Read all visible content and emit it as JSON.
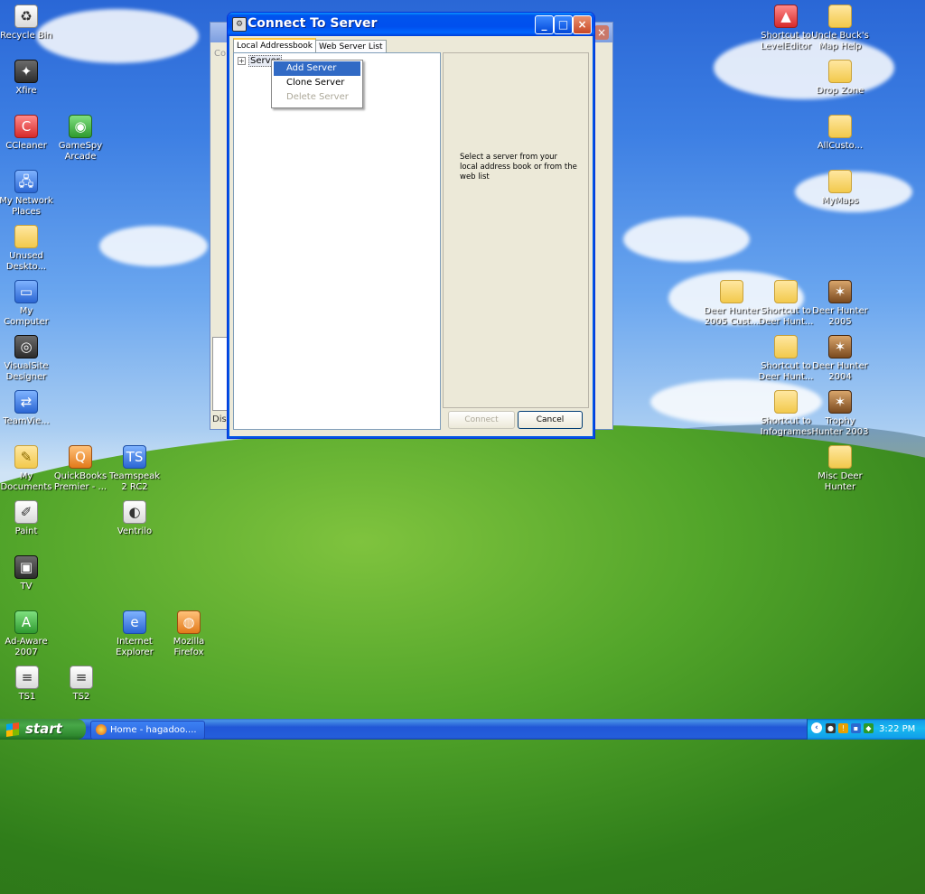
{
  "desktop": {
    "icons": [
      {
        "label": "Recycle Bin",
        "icon": "recycle-bin-icon",
        "glyph": "♻",
        "style": "white"
      },
      {
        "label": "Xfire",
        "icon": "xfire-icon",
        "glyph": "✦",
        "style": "dark"
      },
      {
        "label": "CCleaner",
        "icon": "ccleaner-icon",
        "glyph": "C",
        "style": "red"
      },
      {
        "label": "GameSpy Arcade",
        "icon": "gamespy-icon",
        "glyph": "◉",
        "style": "green"
      },
      {
        "label": "My Network Places",
        "icon": "network-places-icon",
        "glyph": "🖧",
        "style": "app"
      },
      {
        "label": "Unused Deskto...",
        "icon": "folder-icon",
        "glyph": "",
        "style": "folder"
      },
      {
        "label": "My Computer",
        "icon": "my-computer-icon",
        "glyph": "▭",
        "style": "app"
      },
      {
        "label": "VisualSite Designer",
        "icon": "visualsite-icon",
        "glyph": "◎",
        "style": "dark"
      },
      {
        "label": "TeamVie...",
        "icon": "teamviewer-icon",
        "glyph": "⇄",
        "style": "app"
      },
      {
        "label": "My Documents",
        "icon": "my-documents-icon",
        "glyph": "✎",
        "style": "folder"
      },
      {
        "label": "QuickBooks Premier - ...",
        "icon": "quickbooks-icon",
        "glyph": "Q",
        "style": "orange"
      },
      {
        "label": "Teamspeak 2 RC2",
        "icon": "teamspeak-icon",
        "glyph": "TS",
        "style": "app"
      },
      {
        "label": "Paint",
        "icon": "paint-icon",
        "glyph": "✐",
        "style": "white"
      },
      {
        "label": "Ventrilo",
        "icon": "ventrilo-icon",
        "glyph": "◐",
        "style": "white"
      },
      {
        "label": "TV",
        "icon": "tv-icon",
        "glyph": "▣",
        "style": "dark"
      },
      {
        "label": "Ad-Aware 2007",
        "icon": "ad-aware-icon",
        "glyph": "A",
        "style": "green"
      },
      {
        "label": "Internet Explorer",
        "icon": "internet-explorer-icon",
        "glyph": "e",
        "style": "app"
      },
      {
        "label": "Mozilla Firefox",
        "icon": "firefox-icon",
        "glyph": "◍",
        "style": "orange"
      },
      {
        "label": "TS1",
        "icon": "ts1-file-icon",
        "glyph": "≡",
        "style": "white"
      },
      {
        "label": "TS2",
        "icon": "ts2-file-icon",
        "glyph": "≡",
        "style": "white"
      },
      {
        "label": "Shortcut to LevelEditor",
        "icon": "leveleditor-icon",
        "glyph": "▲",
        "style": "red"
      },
      {
        "label": "Uncle Buck's Map Help",
        "icon": "folder-icon",
        "glyph": "",
        "style": "folder"
      },
      {
        "label": "Drop Zone",
        "icon": "folder-icon",
        "glyph": "",
        "style": "folder"
      },
      {
        "label": "AllCusto...",
        "icon": "folder-icon",
        "glyph": "",
        "style": "folder"
      },
      {
        "label": "MyMaps",
        "icon": "folder-icon",
        "glyph": "",
        "style": "folder"
      },
      {
        "label": "Deer Hunter 2005 Cust...",
        "icon": "folder-icon",
        "glyph": "",
        "style": "folder"
      },
      {
        "label": "Shortcut to Deer Hunt...",
        "icon": "folder-shortcut-icon",
        "glyph": "",
        "style": "folder"
      },
      {
        "label": "Deer Hunter 2005",
        "icon": "deer-hunter-2005-icon",
        "glyph": "✶",
        "style": "brown"
      },
      {
        "label": "Shortcut to Deer Hunt...",
        "icon": "folder-shortcut-icon",
        "glyph": "",
        "style": "folder"
      },
      {
        "label": "Deer Hunter 2004",
        "icon": "deer-hunter-2004-icon",
        "glyph": "✶",
        "style": "brown"
      },
      {
        "label": "Shortcut to Infogrames",
        "icon": "folder-shortcut-icon",
        "glyph": "",
        "style": "folder"
      },
      {
        "label": "Trophy Hunter 2003",
        "icon": "trophy-hunter-icon",
        "glyph": "✶",
        "style": "brown"
      },
      {
        "label": "Misc Deer Hunter",
        "icon": "folder-icon",
        "glyph": "",
        "style": "folder"
      }
    ]
  },
  "background_window": {
    "top_text": "Co",
    "bottom_text": "Disc"
  },
  "dialog": {
    "title": "Connect To Server",
    "tabs": [
      "Local Addressbook",
      "Web Server List"
    ],
    "tree_root": "Server",
    "tree_expander": "+",
    "info_text": "Select a server from your local address book or from the web list",
    "connect_label": "Connect",
    "cancel_label": "Cancel"
  },
  "context_menu": {
    "items": [
      {
        "label": "Add Server",
        "state": "selected"
      },
      {
        "label": "Clone Server",
        "state": "enabled"
      },
      {
        "label": "Delete Server",
        "state": "disabled"
      }
    ]
  },
  "taskbar": {
    "start_label": "start",
    "task_label": "Home - hagadoo....",
    "clock": "3:22 PM"
  }
}
